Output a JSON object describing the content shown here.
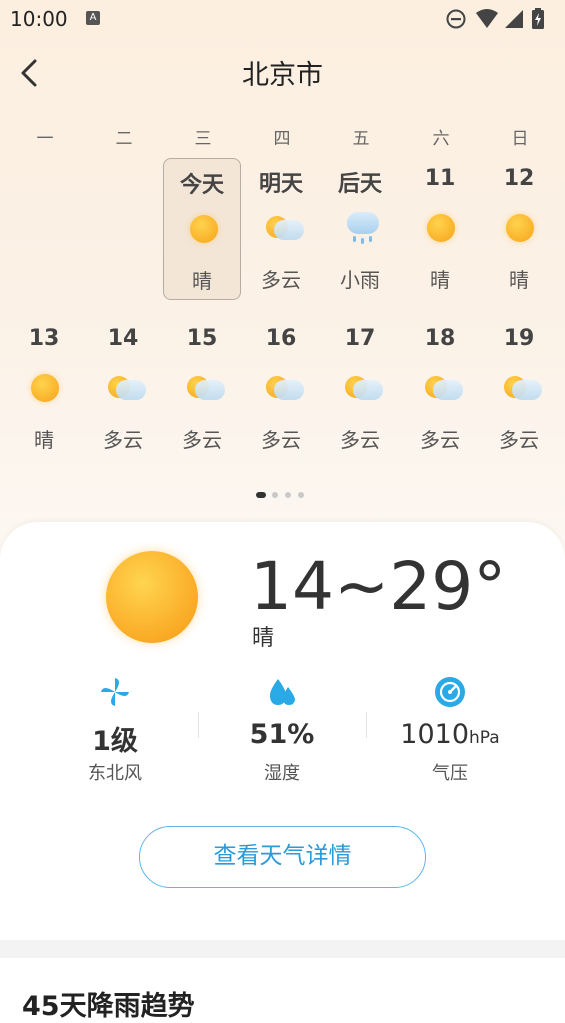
{
  "status_bar": {
    "time": "10:00",
    "notification_icon_letter": "A",
    "icons": [
      "dnd-icon",
      "wifi-icon",
      "signal-icon",
      "battery-icon"
    ]
  },
  "header": {
    "title": "北京市",
    "back_icon": "chevron-left-icon"
  },
  "calendar": {
    "weekdays": [
      "一",
      "二",
      "三",
      "四",
      "五",
      "六",
      "日"
    ],
    "days": [
      {
        "label": "今天",
        "condition": "晴",
        "icon": "sunny",
        "selected": true
      },
      {
        "label": "明天",
        "condition": "多云",
        "icon": "partly-cloudy"
      },
      {
        "label": "后天",
        "condition": "小雨",
        "icon": "light-rain"
      },
      {
        "label": "11",
        "condition": "晴",
        "icon": "sunny"
      },
      {
        "label": "12",
        "condition": "晴",
        "icon": "sunny"
      },
      {
        "label": "13",
        "condition": "晴",
        "icon": "sunny"
      },
      {
        "label": "14",
        "condition": "多云",
        "icon": "partly-cloudy"
      },
      {
        "label": "15",
        "condition": "多云",
        "icon": "partly-cloudy"
      },
      {
        "label": "16",
        "condition": "多云",
        "icon": "partly-cloudy"
      },
      {
        "label": "17",
        "condition": "多云",
        "icon": "partly-cloudy"
      },
      {
        "label": "18",
        "condition": "多云",
        "icon": "partly-cloudy"
      },
      {
        "label": "19",
        "condition": "多云",
        "icon": "partly-cloudy"
      }
    ],
    "page_count": 4,
    "current_page": 1
  },
  "today": {
    "temp_range": "14~29°",
    "condition": "晴",
    "wind": {
      "value": "1级",
      "label": "东北风",
      "icon": "wind-icon"
    },
    "humidity": {
      "value": "51%",
      "label": "湿度",
      "icon": "humidity-icon"
    },
    "pressure": {
      "value": "1010",
      "unit": "hPa",
      "label": "气压",
      "icon": "pressure-icon"
    }
  },
  "detail_button": "查看天气详情",
  "section": {
    "title": "45天降雨趋势"
  },
  "colors": {
    "accent": "#2a9ad8",
    "sun": "#f7a21a",
    "icon_blue": "#29a9e6"
  }
}
